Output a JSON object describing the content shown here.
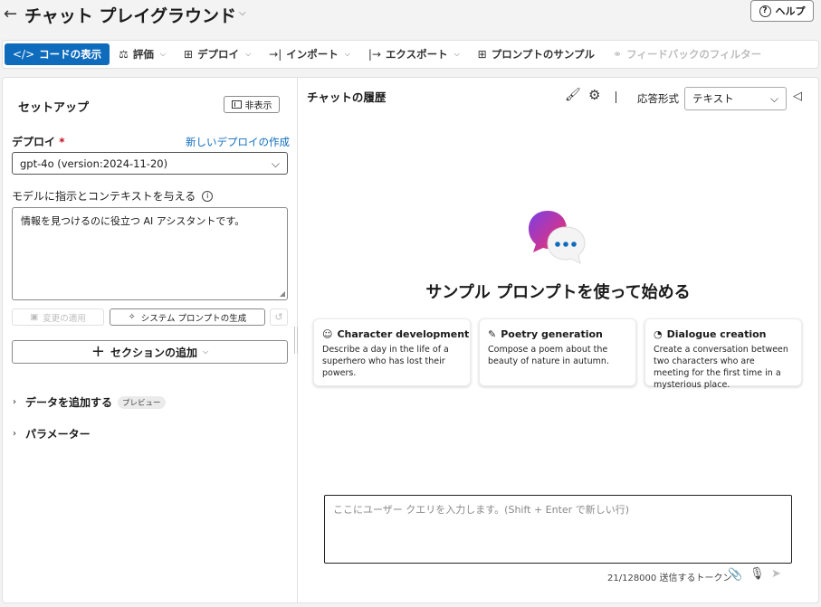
{
  "header": {
    "back_glyph": "←",
    "title": "チャット プレイグラウンド",
    "title_chevron": "⌵",
    "help_label": "ヘルプ",
    "help_glyph": "?"
  },
  "toolbar": {
    "code_view": "コードの表示",
    "evaluate": "評価",
    "deploy": "デプロイ",
    "import": "インポート",
    "export": "エクスポート",
    "prompt_samples": "プロンプトのサンプル",
    "feedback_filter": "フィードバックのフィルター"
  },
  "setup": {
    "title": "セットアップ",
    "hide_label": "非表示",
    "deploy_label": "デプロイ",
    "required_mark": "*",
    "new_deploy_link": "新しいデプロイの作成",
    "deploy_value": "gpt-4o (version:2024-11-20)",
    "instructions_label": "モデルに指示とコンテキストを与える",
    "instructions_value": "情報を見つけるのに役立つ AI アシスタントです。",
    "apply_changes": "変更の適用",
    "generate_system_prompt": "システム プロンプトの生成",
    "add_section": "セクションの追加",
    "add_data": "データを追加する",
    "preview_badge": "プレビュー",
    "parameters": "パラメーター"
  },
  "chat": {
    "history_title": "チャットの履歴",
    "response_format_label": "応答形式",
    "response_format_value": "テキスト",
    "hero_title": "サンプル プロンプトを使って始める",
    "cards": [
      {
        "title": "Character development",
        "desc": "Describe a day in the life of a superhero who has lost their powers.",
        "icon": "people-icon"
      },
      {
        "title": "Poetry generation",
        "desc": "Compose a poem about the beauty of nature in autumn.",
        "icon": "pen-icon"
      },
      {
        "title": "Dialogue creation",
        "desc": "Create a conversation between two characters who are meeting for the first time in a mysterious place.",
        "icon": "chat-bubble-icon"
      }
    ],
    "query_placeholder": "ここにユーザー クエリを入力します。(Shift + Enter で新しい行)",
    "token_count": "21/128000 送信するトークン"
  },
  "colors": {
    "accent": "#0f6cbd",
    "required": "#c50f1f"
  }
}
